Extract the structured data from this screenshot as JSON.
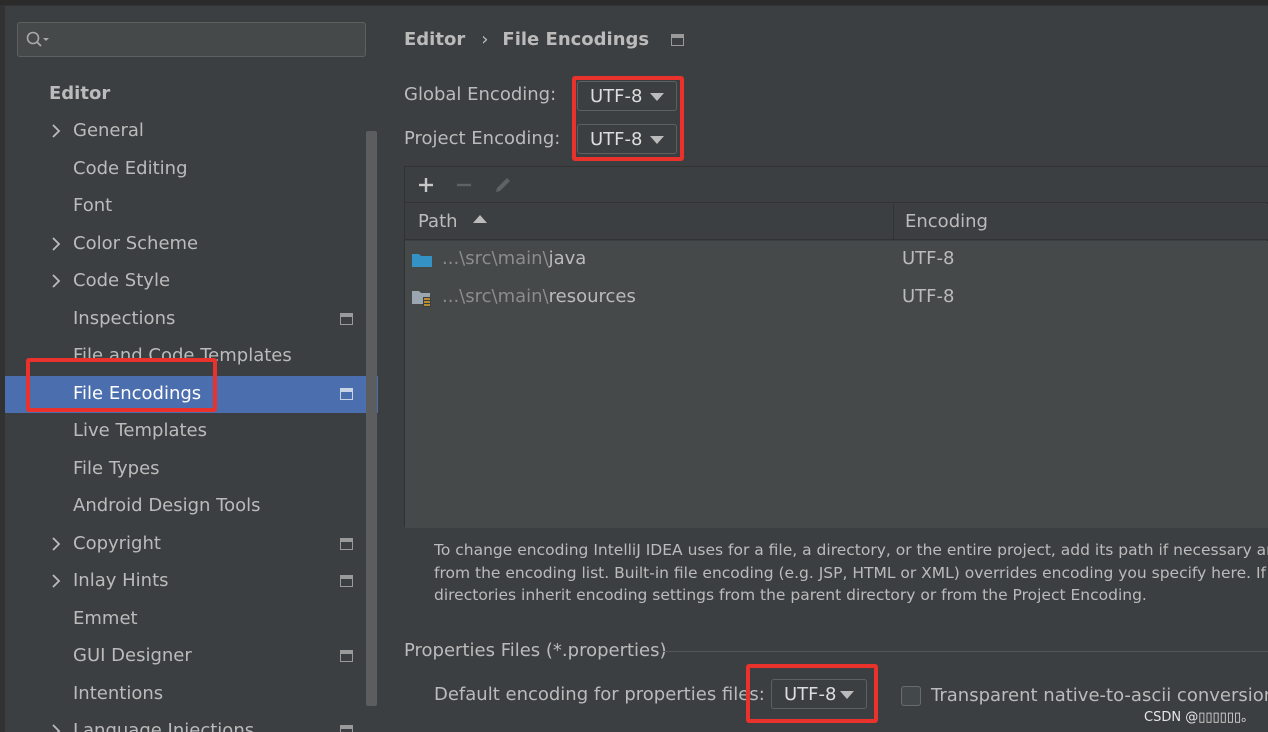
{
  "search": {
    "value": "",
    "placeholder": ""
  },
  "sidebar": {
    "heading": "Editor",
    "items": [
      {
        "label": "General",
        "expandable": true,
        "scoped": false
      },
      {
        "label": "Code Editing",
        "expandable": false,
        "scoped": false
      },
      {
        "label": "Font",
        "expandable": false,
        "scoped": false
      },
      {
        "label": "Color Scheme",
        "expandable": true,
        "scoped": false
      },
      {
        "label": "Code Style",
        "expandable": true,
        "scoped": false
      },
      {
        "label": "Inspections",
        "expandable": false,
        "scoped": true
      },
      {
        "label": "File and Code Templates",
        "expandable": false,
        "scoped": false
      },
      {
        "label": "File Encodings",
        "expandable": false,
        "scoped": true,
        "selected": true
      },
      {
        "label": "Live Templates",
        "expandable": false,
        "scoped": false
      },
      {
        "label": "File Types",
        "expandable": false,
        "scoped": false
      },
      {
        "label": "Android Design Tools",
        "expandable": false,
        "scoped": false
      },
      {
        "label": "Copyright",
        "expandable": true,
        "scoped": true
      },
      {
        "label": "Inlay Hints",
        "expandable": true,
        "scoped": true
      },
      {
        "label": "Emmet",
        "expandable": false,
        "scoped": false
      },
      {
        "label": "GUI Designer",
        "expandable": false,
        "scoped": true
      },
      {
        "label": "Intentions",
        "expandable": false,
        "scoped": false
      },
      {
        "label": "Language Injections",
        "expandable": true,
        "scoped": true
      }
    ]
  },
  "breadcrumb": {
    "parent": "Editor",
    "separator": "›",
    "current": "File Encodings"
  },
  "encodings": {
    "global_label": "Global Encoding:",
    "global_value": "UTF-8",
    "project_label": "Project Encoding:",
    "project_value": "UTF-8"
  },
  "table": {
    "columns": {
      "path": "Path",
      "encoding": "Encoding"
    },
    "rows": [
      {
        "path_prefix": "...\\src\\main\\",
        "path_name": "java",
        "encoding": "UTF-8",
        "icon": "folder-icon"
      },
      {
        "path_prefix": "...\\src\\main\\",
        "path_name": "resources",
        "encoding": "UTF-8",
        "icon": "resources-folder-icon"
      }
    ]
  },
  "help": {
    "line1": "To change encoding IntelliJ IDEA uses for a file, a directory, or the entire project, add its path if necessary and",
    "line2": "from the encoding list. Built-in file encoding (e.g. JSP, HTML or XML) overrides encoding you specify here. If n",
    "line3": "directories inherit encoding settings from the parent directory or from the Project Encoding."
  },
  "properties": {
    "section_title": "Properties Files (*.properties)",
    "default_label": "Default encoding for properties files:",
    "default_value": "UTF-8",
    "transparent_label": "Transparent native-to-ascii conversion",
    "transparent_checked": false
  },
  "watermark": "CSDN @▯▯▯▯▯▯。",
  "colors": {
    "selection": "#4b6eaf",
    "highlight": "#e8322b",
    "folder": "#3592c4"
  }
}
